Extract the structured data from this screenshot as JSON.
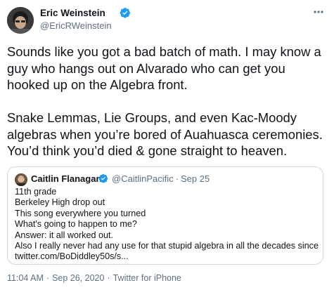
{
  "author": {
    "name": "Eric Weinstein",
    "handle": "@EricRWeinstein",
    "verified": true
  },
  "tweet_text": "Sounds like you got a bad batch of math. I may know a guy who hangs out on Alvarado who can get you hooked up on the Algebra front.\n\nSnake Lemmas, Lie Groups, and even Kac-Moody algebras when you’re bored of Auahuasca ceremonies. You’d think you’d died & gone straight to heaven.",
  "quoted_tweet": {
    "name": "Caitlin Flanagan",
    "handle": "@CaitlinPacific",
    "separator": "·",
    "date": "Sep 25",
    "verified": true,
    "lines": [
      "11th grade",
      "Berkeley High drop out",
      "This song everywhere you turned",
      "What's going to happen to me?",
      "Answer: it all worked out.",
      "Also I really never had any use for that stupid algebra in all the decades since",
      "twitter.com/BoDiddley50s/s..."
    ]
  },
  "meta": {
    "time": "11:04 AM",
    "separator": "·",
    "date": "Sep 26, 2020",
    "source": "Twitter for iPhone"
  },
  "colors": {
    "text": "#0f1419",
    "secondary": "#5b7083",
    "verified": "#1d9bf0",
    "border": "#cfd9de"
  },
  "icons": {
    "verified": "verified-badge-icon",
    "more": "more-options-icon"
  }
}
